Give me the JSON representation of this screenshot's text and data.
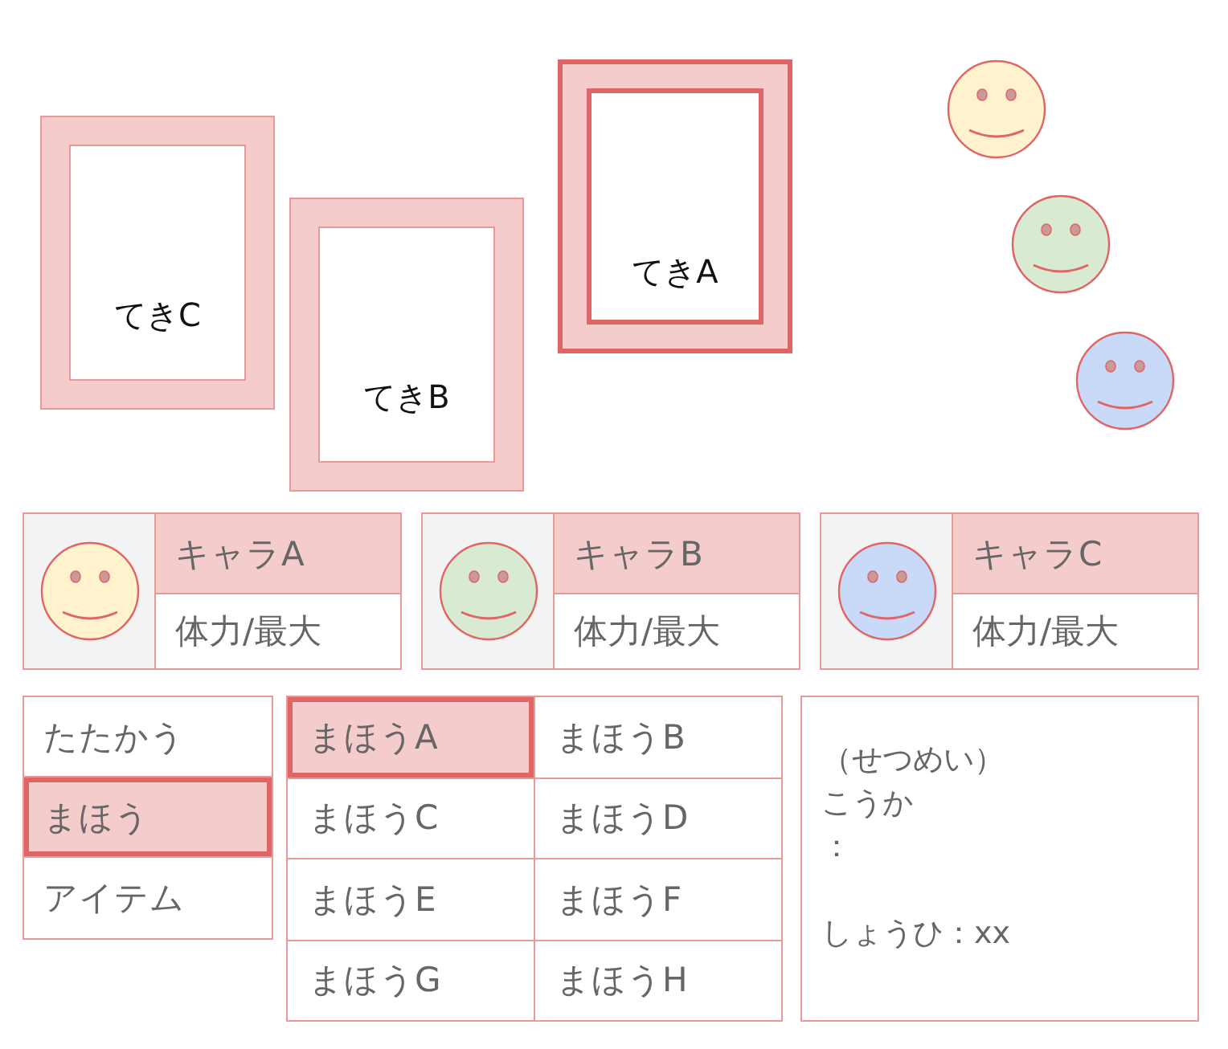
{
  "enemies": [
    {
      "name": "てきC",
      "selected": false
    },
    {
      "name": "てきB",
      "selected": false
    },
    {
      "name": "てきA",
      "selected": true
    }
  ],
  "party_faces": [
    {
      "color": "#fff2cc"
    },
    {
      "color": "#d9ead3"
    },
    {
      "color": "#c9daf8"
    }
  ],
  "party": [
    {
      "name": "キャラA",
      "hp": "体力/最大",
      "color": "#fff2cc"
    },
    {
      "name": "キャラB",
      "hp": "体力/最大",
      "color": "#d9ead3"
    },
    {
      "name": "キャラC",
      "hp": "体力/最大",
      "color": "#c9daf8"
    }
  ],
  "commands": [
    {
      "label": "たたかう",
      "selected": false
    },
    {
      "label": "まほう",
      "selected": true
    },
    {
      "label": "アイテム",
      "selected": false
    }
  ],
  "spells": [
    {
      "label": "まほうA",
      "selected": true
    },
    {
      "label": "まほうB",
      "selected": false
    },
    {
      "label": "まほうC",
      "selected": false
    },
    {
      "label": "まほうD",
      "selected": false
    },
    {
      "label": "まほうE",
      "selected": false
    },
    {
      "label": "まほうF",
      "selected": false
    },
    {
      "label": "まほうG",
      "selected": false
    },
    {
      "label": "まほうH",
      "selected": false
    }
  ],
  "description": [
    {
      "text": "（せつめい）",
      "kind": "line"
    },
    {
      "text": "こうか",
      "kind": "line"
    },
    {
      "text": "：",
      "kind": "line"
    },
    {
      "text": "しょうひ：xx",
      "kind": "footer"
    }
  ]
}
